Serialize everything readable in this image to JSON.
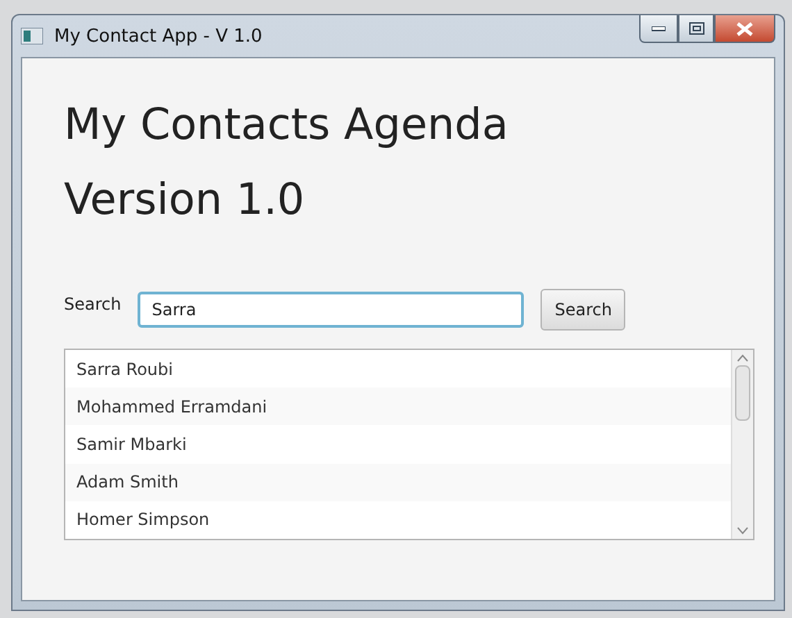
{
  "window": {
    "title": "My Contact App - V 1.0"
  },
  "heading": "My Contacts Agenda",
  "version": "Version 1.0",
  "search": {
    "label": "Search",
    "value": "Sarra",
    "button": "Search"
  },
  "contacts": [
    {
      "name": "Sarra Roubi"
    },
    {
      "name": "Mohammed Erramdani"
    },
    {
      "name": "Samir Mbarki"
    },
    {
      "name": "Adam Smith"
    },
    {
      "name": "Homer Simpson"
    }
  ]
}
